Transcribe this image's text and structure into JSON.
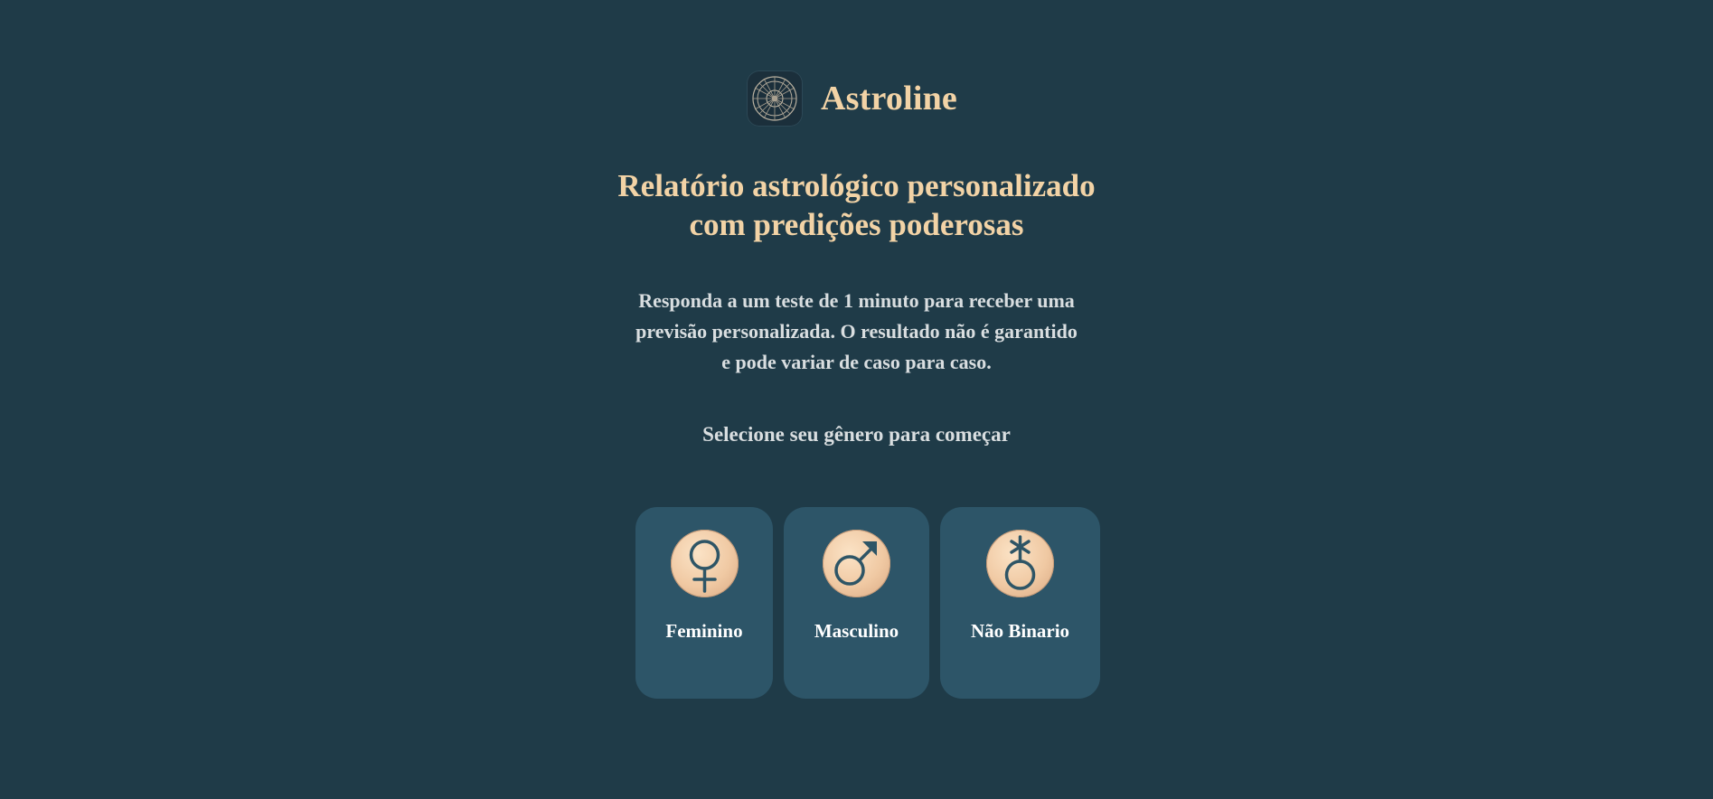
{
  "brand": {
    "name": "Astroline",
    "logo_icon": "zodiac-wheel-icon"
  },
  "headline": {
    "line1": "Relatório astrológico personalizado",
    "line2": "com predições poderosas"
  },
  "subtitle": {
    "line1": "Responda a um teste de 1 minuto para receber uma",
    "line2": "previsão personalizada. O resultado não é garantido",
    "line3": "e pode variar de caso para caso."
  },
  "prompt": "Selecione seu gênero para começar",
  "gender_options": [
    {
      "label": "Feminino",
      "icon": "female-symbol-icon"
    },
    {
      "label": "Masculino",
      "icon": "male-symbol-icon"
    },
    {
      "label": "Não Binario",
      "icon": "nonbinary-symbol-icon"
    }
  ],
  "colors": {
    "background": "#1f3b48",
    "card": "#2d5568",
    "accent_text": "#f2d3a6",
    "body_text": "#d9dee0",
    "icon_stroke": "#2e5566"
  }
}
